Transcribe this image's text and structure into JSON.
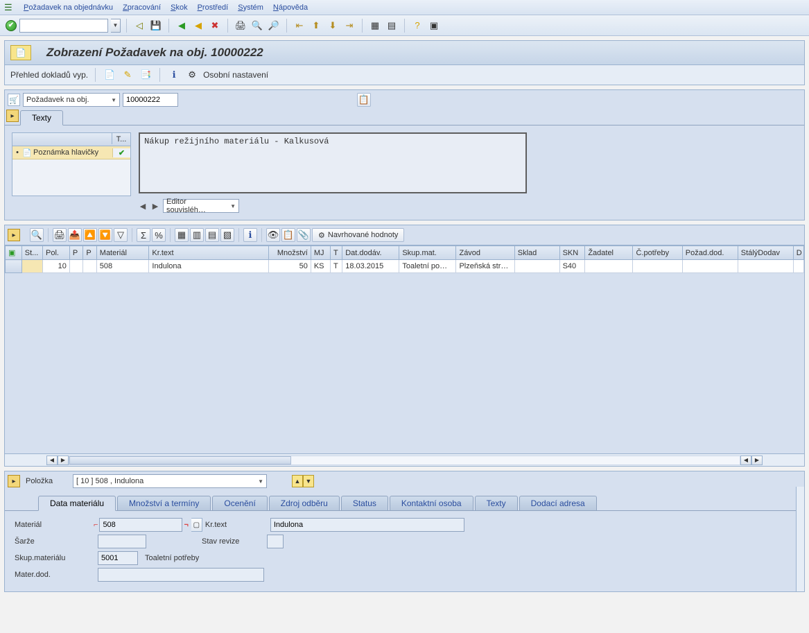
{
  "menu": {
    "items": [
      {
        "full": "Požadavek na objednávku",
        "u": "P"
      },
      {
        "full": "Zpracování",
        "u": "Z"
      },
      {
        "full": "Skok",
        "u": "S"
      },
      {
        "full": "Prostředí",
        "u": "P"
      },
      {
        "full": "Systém",
        "u": "S"
      },
      {
        "full": "Nápověda",
        "u": "N"
      }
    ]
  },
  "title": "Zobrazení Požadavek na obj. 10000222",
  "appToolbar": {
    "overview": "Přehled dokladů vyp.",
    "personal": "Osobní nastavení"
  },
  "header": {
    "docTypeLabel": "Požadavek na obj.",
    "docNumber": "10000222",
    "tabs": [
      "Texty"
    ],
    "textTree": {
      "col2": "T...",
      "rowLabel": "Poznámka hlavičky",
      "statusIcon": "✔"
    },
    "longText": "Nákup režijního materiálu - Kalkusová",
    "editorLabel": "Editor souvisléh…"
  },
  "grid": {
    "navBtn": "Navrhované hodnoty",
    "columns": [
      "",
      "St...",
      "Pol.",
      "P",
      "P",
      "Materiál",
      "Kr.text",
      "Množství",
      "MJ",
      "T",
      "Dat.dodáv.",
      "Skup.mat.",
      "Závod",
      "Sklad",
      "SKN",
      "Žadatel",
      "Č.potřeby",
      "Požad.dod.",
      "StálýDodav",
      "D"
    ],
    "row": {
      "pol": "10",
      "material": "508",
      "krtext": "Indulona",
      "qty": "50",
      "mj": "KS",
      "t": "T",
      "date": "18.03.2015",
      "skupmat": "Toaletní po…",
      "zavod": "Plzeňská str…",
      "skn": "S40"
    }
  },
  "item": {
    "label": "Položka",
    "current": "[ 10 ] 508 , Indulona",
    "tabs": [
      "Data materiálu",
      "Množství a termíny",
      "Ocenění",
      "Zdroj odběru",
      "Status",
      "Kontaktní osoba",
      "Texty",
      "Dodací adresa"
    ],
    "fields": {
      "material_lbl": "Materiál",
      "material_val": "508",
      "krtext_lbl": "Kr.text",
      "krtext_val": "Indulona",
      "sarze_lbl": "Šarže",
      "sarze_val": "",
      "revize_lbl": "Stav revize",
      "revize_val": "",
      "skupmat_lbl": "Skup.materiálu",
      "skupmat_val": "5001",
      "skupmat_txt": "Toaletní potřeby",
      "materdod_lbl": "Mater.dod.",
      "materdod_val": ""
    }
  }
}
